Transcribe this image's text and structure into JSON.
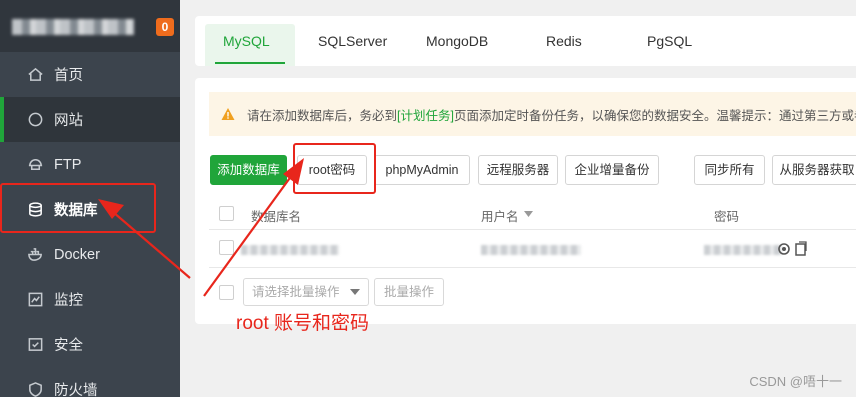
{
  "sidebar": {
    "badge": "0",
    "items": [
      {
        "label": "首页",
        "icon": "home-icon"
      },
      {
        "label": "网站",
        "icon": "globe-icon"
      },
      {
        "label": "FTP",
        "icon": "ftp-icon"
      },
      {
        "label": "数据库",
        "icon": "database-icon"
      },
      {
        "label": "Docker",
        "icon": "docker-icon"
      },
      {
        "label": "监控",
        "icon": "monitor-icon"
      },
      {
        "label": "安全",
        "icon": "shield-icon"
      },
      {
        "label": "防火墙",
        "icon": "firewall-icon"
      }
    ]
  },
  "tabs": [
    "MySQL",
    "SQLServer",
    "MongoDB",
    "Redis",
    "PgSQL"
  ],
  "notice": {
    "before": "请在添加数据库后，务必到",
    "link": "[计划任务]",
    "after": "页面添加定时备份任务，以确保您的数据安全。温馨提示：通过第三方或者My"
  },
  "toolbar": {
    "add": "添加数据库",
    "root": "root密码",
    "phpmyadmin": "phpMyAdmin",
    "remote": "远程服务器",
    "backup": "企业增量备份",
    "sync_all": "同步所有",
    "fetch": "从服务器获取"
  },
  "table": {
    "headers": [
      "数据库名",
      "用户名",
      "密码"
    ]
  },
  "batch": {
    "placeholder": "请选择批量操作",
    "button": "批量操作"
  },
  "annotation": "root 账号和密码",
  "watermark": "CSDN @唔十一",
  "colors": {
    "accent": "#20a53a",
    "annotation": "#e8261c",
    "sidebar": "#3c444d",
    "badge": "#ef6c1d"
  }
}
